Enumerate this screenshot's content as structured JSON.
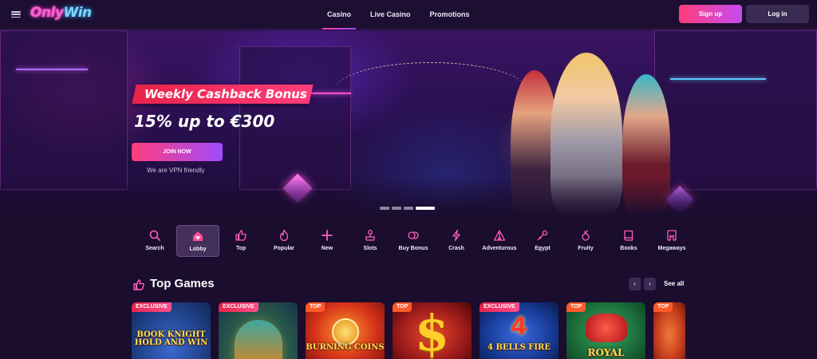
{
  "header": {
    "logo_text_a": "Only",
    "logo_text_b": "Win",
    "nav": [
      {
        "label": "Casino",
        "active": true
      },
      {
        "label": "Live Casino",
        "active": false
      },
      {
        "label": "Promotions",
        "active": false
      }
    ],
    "signup_label": "Sign up",
    "login_label": "Log in"
  },
  "hero": {
    "bonus_title": "Weekly Cashback Bonus",
    "bonus_offer": "15% up to €300",
    "cta_label": "JOIN NOW",
    "vpn_note": "We are VPN friendly",
    "slides_total": 4,
    "slide_active": 4
  },
  "categories": [
    {
      "label": "Search",
      "icon": "search-icon"
    },
    {
      "label": "Lobby",
      "icon": "lobby-icon",
      "active": true
    },
    {
      "label": "Top",
      "icon": "thumbs-up-icon"
    },
    {
      "label": "Popular",
      "icon": "flame-icon"
    },
    {
      "label": "New",
      "icon": "plus-icon"
    },
    {
      "label": "Slots",
      "icon": "joystick-icon"
    },
    {
      "label": "Buy Bonus",
      "icon": "coins-icon"
    },
    {
      "label": "Crash",
      "icon": "lightning-icon"
    },
    {
      "label": "Adventurous",
      "icon": "tent-icon"
    },
    {
      "label": "Egypt",
      "icon": "ankh-icon"
    },
    {
      "label": "Fruity",
      "icon": "cherry-icon"
    },
    {
      "label": "Books",
      "icon": "book-icon"
    },
    {
      "label": "Megaways",
      "icon": "megaways-icon"
    }
  ],
  "top_games": {
    "title": "Top Games",
    "see_all_label": "See all",
    "prev_label": "‹",
    "next_label": "›",
    "games": [
      {
        "badge": "EXCLUSIVE",
        "title": "BOOK KNIGHT HOLD AND WIN",
        "bg": "#1b3f86"
      },
      {
        "badge": "EXCLUSIVE",
        "title": "",
        "bg": "#2a6a4a"
      },
      {
        "badge": "TOP",
        "title": "BURNING COINS",
        "bg": "#d6331a"
      },
      {
        "badge": "TOP",
        "title": "",
        "bg": "#b5241f"
      },
      {
        "badge": "EXCLUSIVE",
        "title": "4 BELLS FIRE",
        "bg": "#173a96"
      },
      {
        "badge": "TOP",
        "title": "ROYAL",
        "bg": "#1a6b3a"
      },
      {
        "badge": "TOP",
        "title": "",
        "bg": "#d8542a"
      }
    ]
  }
}
